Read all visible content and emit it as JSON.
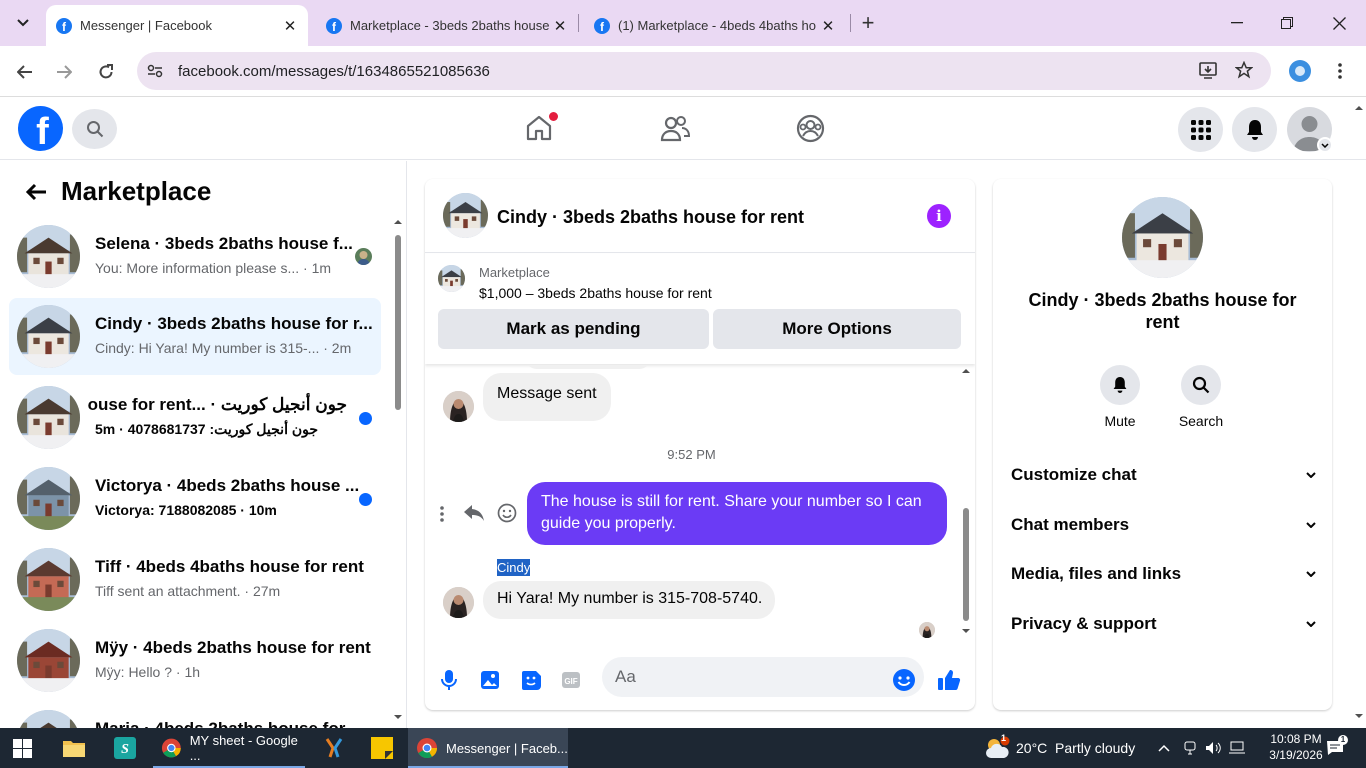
{
  "browser": {
    "tabs": [
      {
        "title": "Messenger | Facebook",
        "active": true
      },
      {
        "title": "Marketplace - 3beds 2baths house",
        "active": false
      },
      {
        "title": "(1) Marketplace - 4beds 4baths ho",
        "active": false
      }
    ],
    "url": "facebook.com/messages/t/1634865521085636",
    "icons": [
      "tab-search-icon",
      "new-tab-icon",
      "minimize-icon",
      "maximize-icon",
      "close-icon",
      "back-icon",
      "forward-icon",
      "reload-icon",
      "site-info-icon",
      "install-icon",
      "star-icon",
      "extension-icon",
      "menu-icon"
    ]
  },
  "fb_nav": {
    "logo": "f",
    "icons": [
      "facebook-logo",
      "search-icon",
      "home-icon",
      "friends-icon",
      "groups-icon",
      "menu-grid-icon",
      "notifications-icon",
      "profile-avatar"
    ]
  },
  "sidebar": {
    "back_label": "←",
    "title": "Marketplace",
    "conversations": [
      {
        "name": "Selena · 3beds 2baths house f...",
        "preview": "You: More information please s...",
        "time": " · 1m",
        "unread": false,
        "selected": false,
        "seen_avatar": true
      },
      {
        "name": "Cindy · 3beds 2baths house for r...",
        "preview": "Cindy: Hi Yara! My number is 315-...",
        "time": " · 2m",
        "unread": false,
        "selected": true,
        "seen_avatar": false
      },
      {
        "name": "جون أنجيل كوريت · ...ouse for rent",
        "preview": "جون أنجيل كوريت: 4078681737",
        "time": " · 5m",
        "unread": true,
        "selected": false,
        "seen_avatar": false
      },
      {
        "name": "Victorya · 4beds 2baths house ...",
        "preview": "Victorya: 7188082085",
        "time": " · 10m",
        "unread": true,
        "selected": false,
        "seen_avatar": false
      },
      {
        "name": "Tiff · 4beds 4baths house for rent",
        "preview": "Tiff sent an attachment.",
        "time": " · 27m",
        "unread": false,
        "selected": false,
        "seen_avatar": false
      },
      {
        "name": "Mÿy · 4beds 2baths house for rent",
        "preview": "Mÿy: Hello ?",
        "time": " · 1h",
        "unread": false,
        "selected": false,
        "seen_avatar": false
      },
      {
        "name": "Maria · 4beds 2baths house for",
        "preview": "",
        "time": "",
        "unread": false,
        "selected": false,
        "seen_avatar": false
      }
    ]
  },
  "chat": {
    "title": "Cindy · 3beds 2baths house for rent",
    "marketplace_label": "Marketplace",
    "listing": "$1,000 – 3beds 2baths house for rent",
    "mark_pending": "Mark as pending",
    "more_options": "More Options",
    "messages": [
      {
        "from": "them",
        "text": "Message sent"
      },
      {
        "from": "me",
        "text": "The house is still for rent. Share your number so I can guide you properly."
      },
      {
        "from": "them",
        "sender": "Cindy",
        "text": "Hi Yara! My number is 315-708-5740."
      }
    ],
    "timestamp": "9:52 PM",
    "input_placeholder": "Aa",
    "accent_color": "#6b3bf5"
  },
  "details": {
    "name": "Cindy · 3beds 2baths house for rent",
    "mute": "Mute",
    "search": "Search",
    "sections": [
      "Customize chat",
      "Chat members",
      "Media, files and links",
      "Privacy & support"
    ]
  },
  "taskbar": {
    "apps": [
      {
        "label": "MY sheet - Google ...",
        "active": false
      },
      {
        "label": "Messenger | Faceb...",
        "active": true
      }
    ],
    "weather": "20°C  Partly cloudy",
    "time": "10:08 PM",
    "date": "3/19/2026",
    "notification_count": "1"
  }
}
